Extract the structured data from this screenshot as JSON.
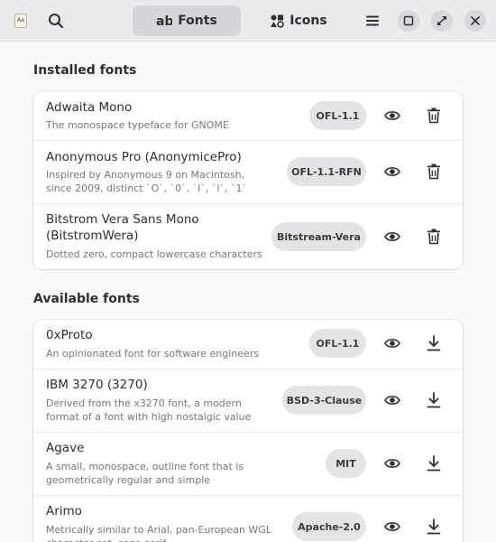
{
  "header": {
    "app_icon_text": "Aa",
    "tabs": [
      {
        "label": "Fonts",
        "icon": "font-icon",
        "selected": true
      },
      {
        "label": "Icons",
        "icon": "icons-icon",
        "selected": false
      }
    ],
    "icons": [
      "search-icon",
      "hamburger-menu-icon",
      "maximize-icon",
      "restore-icon",
      "close-icon"
    ]
  },
  "installed": {
    "title": "Installed fonts",
    "items": [
      {
        "name": "Adwaita Mono",
        "description": "The monospace typeface for GNOME",
        "license": "OFL-1.1"
      },
      {
        "name": "Anonymous Pro (AnonymicePro)",
        "description": "Inspired by Anonymous 9 on Macintosh, since 2009, distinct `O`, `0`, `I`, `l`, `1`",
        "license": "OFL-1.1-RFN"
      },
      {
        "name": "Bitstrom Vera Sans Mono (BitstromWera)",
        "description": "Dotted zero, compact lowercase characters",
        "license": "Bitstream-Vera"
      }
    ]
  },
  "available": {
    "title": "Available fonts",
    "items": [
      {
        "name": "0xProto",
        "description": "An opinionated font for software engineers",
        "license": "OFL-1.1"
      },
      {
        "name": "IBM 3270 (3270)",
        "description": "Derived from the x3270 font, a modern format of a font with high nostalgic value",
        "license": "BSD-3-Clause"
      },
      {
        "name": "Agave",
        "description": "A small, monospace, outline font that is geometrically regular and simple",
        "license": "MIT"
      },
      {
        "name": "Arimo",
        "description": "Metrically similar to Arial, pan-European WGL character set, sans-serif",
        "license": "Apache-2.0"
      }
    ]
  }
}
